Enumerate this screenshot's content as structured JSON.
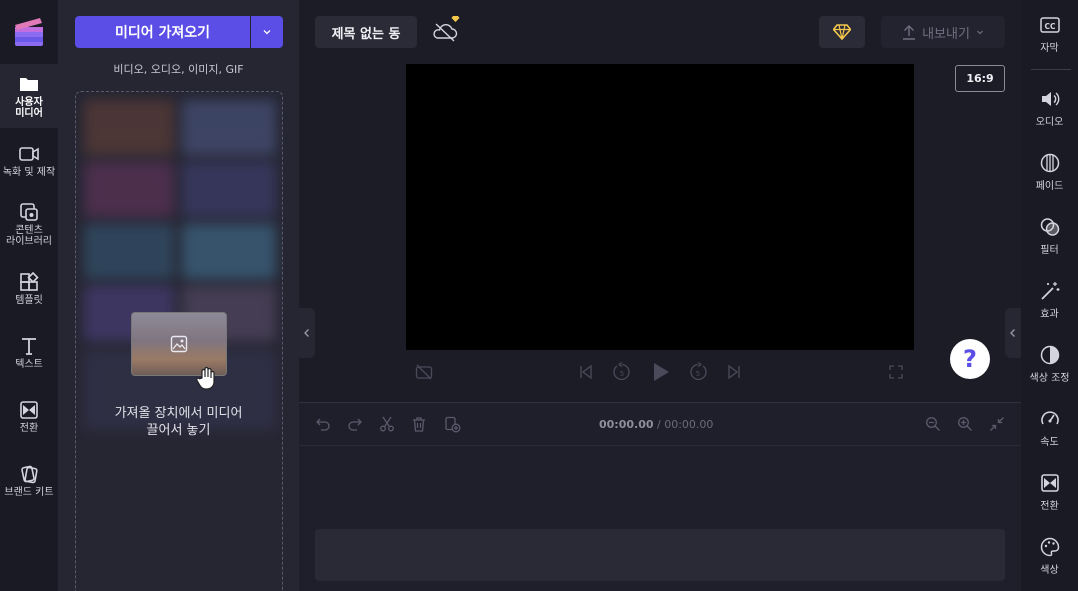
{
  "left_nav": {
    "items": [
      {
        "label": "사용자 미디어",
        "icon": "folder-icon"
      },
      {
        "label": "녹화 및 제작",
        "icon": "video-camera-icon"
      },
      {
        "label": "콘텐츠 라이브러리",
        "icon": "content-library-icon"
      },
      {
        "label": "템플릿",
        "icon": "templates-icon"
      },
      {
        "label": "텍스트",
        "icon": "text-icon"
      },
      {
        "label": "전환",
        "icon": "transitions-icon"
      },
      {
        "label": "브랜드 키트",
        "icon": "brand-kit-icon"
      }
    ]
  },
  "media_panel": {
    "import_label": "미디어 가져오기",
    "import_hint": "비디오, 오디오, 이미지, GIF",
    "drop_line1": "가져올 장치에서 미디어",
    "drop_line2": "끌어서 놓기"
  },
  "header": {
    "project_title": "제목 없는 동",
    "export_label": "내보내기",
    "aspect_ratio": "16:9"
  },
  "timeline": {
    "current_time": "00:00.00",
    "separator": " / ",
    "total_time": "00:00.00"
  },
  "right_nav": {
    "items": [
      {
        "label": "자막",
        "icon": "captions-icon"
      },
      {
        "label": "오디오",
        "icon": "audio-icon"
      },
      {
        "label": "페이드",
        "icon": "fade-icon"
      },
      {
        "label": "필터",
        "icon": "filters-icon"
      },
      {
        "label": "효과",
        "icon": "effects-icon"
      },
      {
        "label": "색상 조정",
        "icon": "color-adjust-icon"
      },
      {
        "label": "속도",
        "icon": "speed-icon"
      },
      {
        "label": "전환",
        "icon": "transition-icon"
      },
      {
        "label": "색상",
        "icon": "color-palette-icon"
      }
    ]
  },
  "colors": {
    "accent": "#5b4ee6",
    "background": "#1c1c27",
    "panel": "#262633",
    "premium_gem": "#f5c84b"
  }
}
